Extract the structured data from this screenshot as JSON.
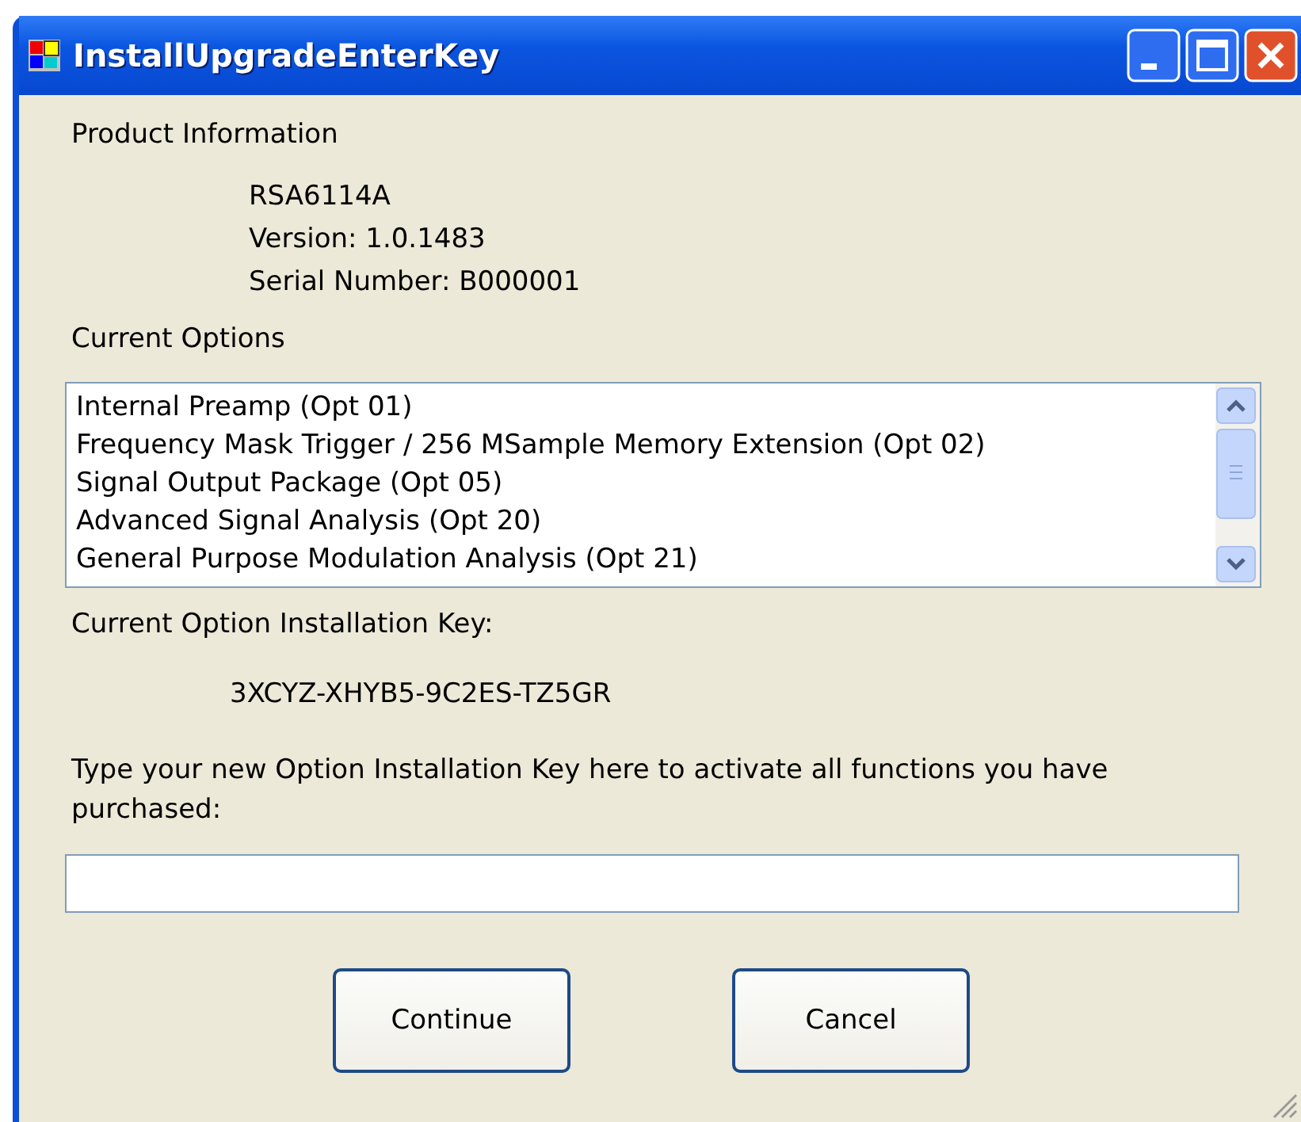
{
  "window": {
    "title": "InstallUpgradeEnterKey"
  },
  "product_info": {
    "heading": "Product Information",
    "lines": [
      "RSA6114A",
      "Version: 1.0.1483",
      "Serial Number: B000001"
    ]
  },
  "current_options": {
    "heading": "Current Options",
    "items": [
      {
        "label": "Internal Preamp (Opt 01)",
        "selected": false
      },
      {
        "label": "Frequency Mask Trigger / 256 MSample Memory Extension (Opt 02)",
        "selected": false
      },
      {
        "label": "Signal Output Package (Opt 05)",
        "selected": false
      },
      {
        "label": "Advanced Signal Analysis (Opt 20)",
        "selected": false
      },
      {
        "label": "General Purpose Modulation Analysis (Opt 21)",
        "selected": false
      }
    ]
  },
  "installation_key": {
    "label": "Current Option Installation Key:",
    "value": "3XCYZ-XHYB5-9C2ES-TZ5GR"
  },
  "new_key": {
    "label": "Type your new Option Installation Key here to activate all functions you have purchased:"
  },
  "buttons": [
    "Continue",
    "Cancel"
  ]
}
